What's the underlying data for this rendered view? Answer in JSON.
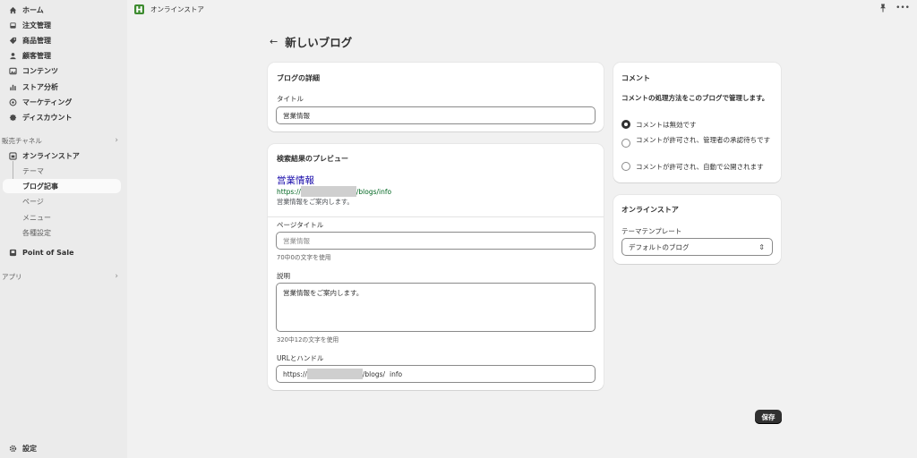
{
  "topbar": {
    "store_title": "オンラインストア"
  },
  "nav": {
    "items": [
      {
        "label": "ホーム",
        "icon": "home-icon"
      },
      {
        "label": "注文管理",
        "icon": "inbox-icon"
      },
      {
        "label": "商品管理",
        "icon": "tag-icon"
      },
      {
        "label": "顧客管理",
        "icon": "person-icon"
      },
      {
        "label": "コンテンツ",
        "icon": "image-icon"
      },
      {
        "label": "ストア分析",
        "icon": "bar-chart-icon"
      },
      {
        "label": "マーケティング",
        "icon": "target-icon"
      },
      {
        "label": "ディスカウント",
        "icon": "discount-icon"
      }
    ],
    "sales_channels_label": "販売チャネル",
    "online_store_label": "オンラインストア",
    "sub_items": [
      "テーマ",
      "ブログ記事",
      "ページ",
      "メニュー",
      "各種設定"
    ],
    "pos_label": "Point of Sale",
    "apps_label": "アプリ",
    "settings_label": "設定"
  },
  "page": {
    "title": "新しいブログ"
  },
  "details": {
    "card_title": "ブログの詳細",
    "title_label": "タイトル",
    "title_value": "営業情報"
  },
  "seo": {
    "card_title": "検索結果のプレビュー",
    "preview_title": "営業情報",
    "preview_url_prefix": "https://",
    "preview_url_suffix": "/blogs/info",
    "preview_desc": "営業情報をご案内します。",
    "page_title_label": "ページタイトル",
    "page_title_placeholder": "営業情報",
    "page_title_help": "70中0の文字を使用",
    "desc_label": "説明",
    "desc_value": "営業情報をご案内します。",
    "desc_help": "320中12の文字を使用",
    "url_label": "URLとハンドル",
    "url_prefix": "https://",
    "url_middle": "/blogs/",
    "url_handle": "info"
  },
  "comments": {
    "card_title": "コメント",
    "description": "コメントの処理方法をこのブログで管理します。",
    "options": [
      {
        "label": "コメントは無効です",
        "checked": true
      },
      {
        "label": "コメントが許可され、管理者の承認待ちです",
        "checked": false
      },
      {
        "label": "コメントが許可され、自動で公開されます",
        "checked": false
      }
    ]
  },
  "online_store": {
    "card_title": "オンラインストア",
    "template_label": "テーマテンプレート",
    "template_value": "デフォルトのブログ"
  },
  "actions": {
    "save_label": "保存"
  },
  "colors": {
    "accent": "#303030",
    "link": "#1a0dab",
    "url": "#006621"
  }
}
